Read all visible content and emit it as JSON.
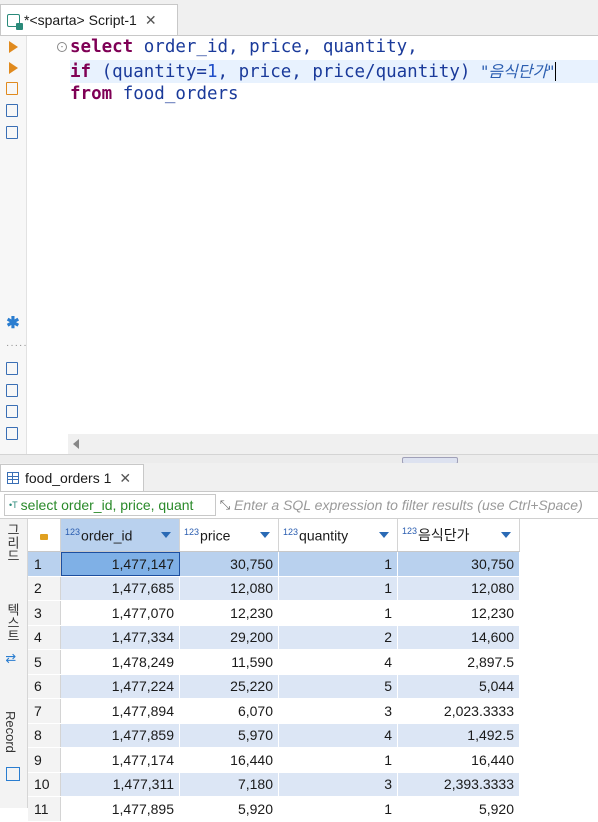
{
  "editor_tab": {
    "title": "*<sparta> Script-1",
    "close": "✕"
  },
  "left_toolbar": [
    "execute-icon",
    "execute-script-icon",
    "explain-plan-icon",
    "load-script-icon",
    "terminal-icon",
    "settings-icon",
    "export-icon",
    "import-icon",
    "format-icon",
    "outline-icon"
  ],
  "sql_lines": [
    [
      {
        "t": "select",
        "c": "kw"
      },
      {
        "t": " order_id, price, quantity,",
        "c": "id"
      }
    ],
    [
      {
        "t": "if",
        "c": "kw"
      },
      {
        "t": " (quantity=",
        "c": "id"
      },
      {
        "t": "1",
        "c": "num"
      },
      {
        "t": ", price, price/quantity) ",
        "c": "id"
      },
      {
        "t": "\"음식단가\"",
        "c": "str"
      }
    ],
    [
      {
        "t": "from",
        "c": "kw"
      },
      {
        "t": " food_orders",
        "c": "id"
      }
    ]
  ],
  "results_tab": {
    "title": "food_orders 1",
    "close": "✕"
  },
  "filter": {
    "sql_text": "select order_id, price, quant",
    "placeholder": "Enter a SQL expression to filter results (use Ctrl+Space)"
  },
  "side_view": {
    "grid_label": "그리드",
    "text_label": "텍스트",
    "record_label": "Record"
  },
  "table": {
    "columns": [
      "order_id",
      "price",
      "quantity",
      "음식단가"
    ],
    "rows": [
      [
        "1",
        "1,477,147",
        "30,750",
        "1",
        "30,750"
      ],
      [
        "2",
        "1,477,685",
        "12,080",
        "1",
        "12,080"
      ],
      [
        "3",
        "1,477,070",
        "12,230",
        "1",
        "12,230"
      ],
      [
        "4",
        "1,477,334",
        "29,200",
        "2",
        "14,600"
      ],
      [
        "5",
        "1,478,249",
        "11,590",
        "4",
        "2,897.5"
      ],
      [
        "6",
        "1,477,224",
        "25,220",
        "5",
        "5,044"
      ],
      [
        "7",
        "1,477,894",
        "6,070",
        "3",
        "2,023.3333"
      ],
      [
        "8",
        "1,477,859",
        "5,970",
        "4",
        "1,492.5"
      ],
      [
        "9",
        "1,477,174",
        "16,440",
        "1",
        "16,440"
      ],
      [
        "10",
        "1,477,311",
        "7,180",
        "3",
        "2,393.3333"
      ],
      [
        "11",
        "1,477,895",
        "5,920",
        "1",
        "5,920"
      ]
    ]
  }
}
